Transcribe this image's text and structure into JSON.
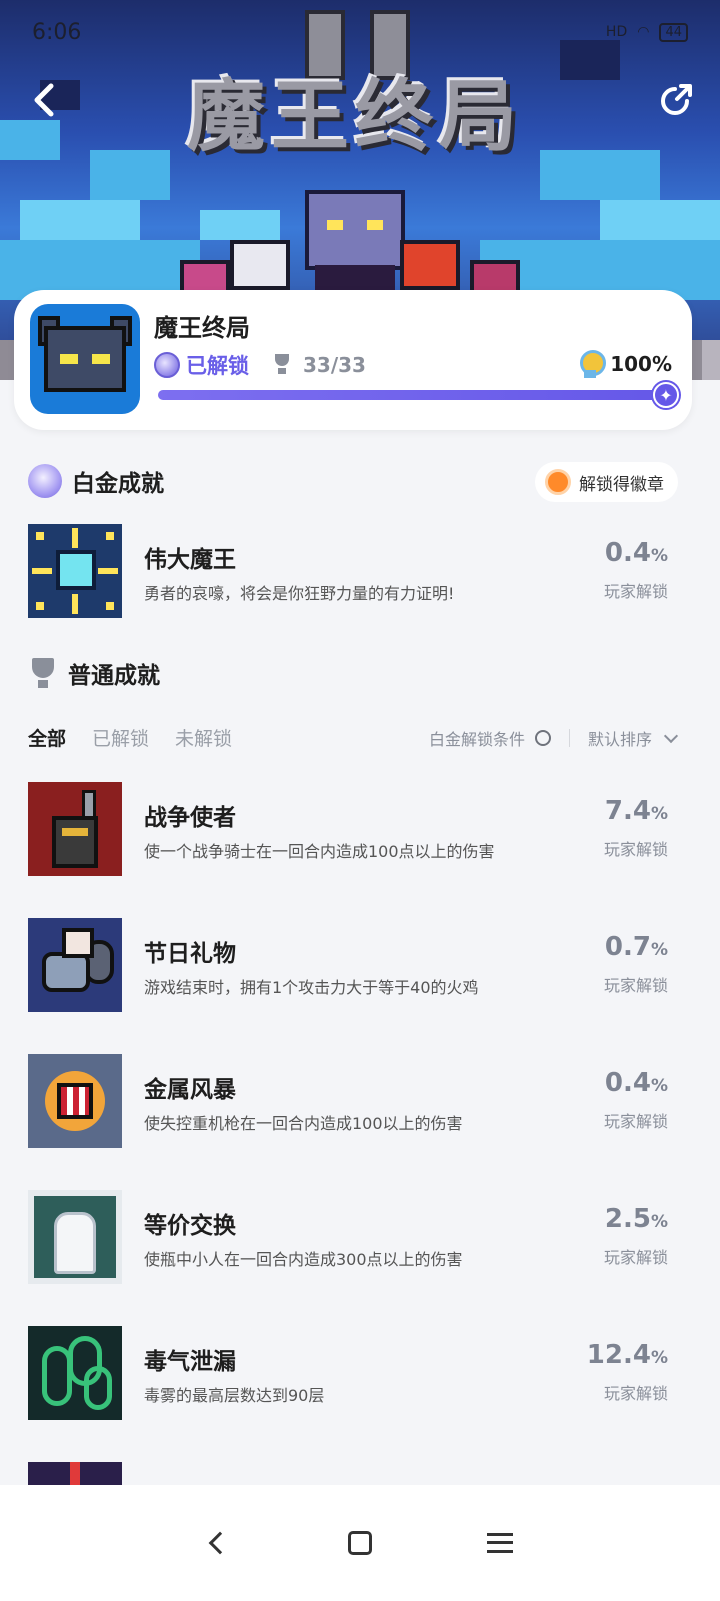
{
  "status_bar": {
    "time": "6:06",
    "signal": "HD",
    "battery": "44"
  },
  "header": {
    "banner_logo_text": "魔王终局",
    "back_icon": "chevron-left-icon",
    "share_icon": "share-icon"
  },
  "game": {
    "title": "魔王终局",
    "unlock_status": "已解锁",
    "trophy_progress": "33/33",
    "completion_percent": "100%",
    "completion_fraction": 1.0
  },
  "platinum_section": {
    "title": "白金成就",
    "badge_button": "解锁得徽章",
    "item": {
      "title": "伟大魔王",
      "desc": "勇者的哀嚎，将会是你狂野力量的有力证明!",
      "pct": "0.4",
      "pct_unit": "%",
      "sub": "玩家解锁"
    }
  },
  "normal_section": {
    "title": "普通成就",
    "tabs": [
      "全部",
      "已解锁",
      "未解锁"
    ],
    "active_tab": "全部",
    "filter_label": "白金解锁条件",
    "sort_label": "默认排序",
    "items": [
      {
        "title": "战争使者",
        "desc": "使一个战争骑士在一回合内造成100点以上的伤害",
        "pct": "7.4",
        "pct_unit": "%",
        "sub": "玩家解锁"
      },
      {
        "title": "节日礼物",
        "desc": "游戏结束时，拥有1个攻击力大于等于40的火鸡",
        "pct": "0.7",
        "pct_unit": "%",
        "sub": "玩家解锁"
      },
      {
        "title": "金属风暴",
        "desc": "使失控重机枪在一回合内造成100以上的伤害",
        "pct": "0.4",
        "pct_unit": "%",
        "sub": "玩家解锁"
      },
      {
        "title": "等价交换",
        "desc": "使瓶中小人在一回合内造成300点以上的伤害",
        "pct": "2.5",
        "pct_unit": "%",
        "sub": "玩家解锁"
      },
      {
        "title": "毒气泄漏",
        "desc": "毒雾的最高层数达到90层",
        "pct": "12.4",
        "pct_unit": "%",
        "sub": "玩家解锁"
      }
    ]
  },
  "colors": {
    "accent": "#6558e8",
    "background": "#f4f5f8",
    "muted": "#8a8f9a"
  }
}
